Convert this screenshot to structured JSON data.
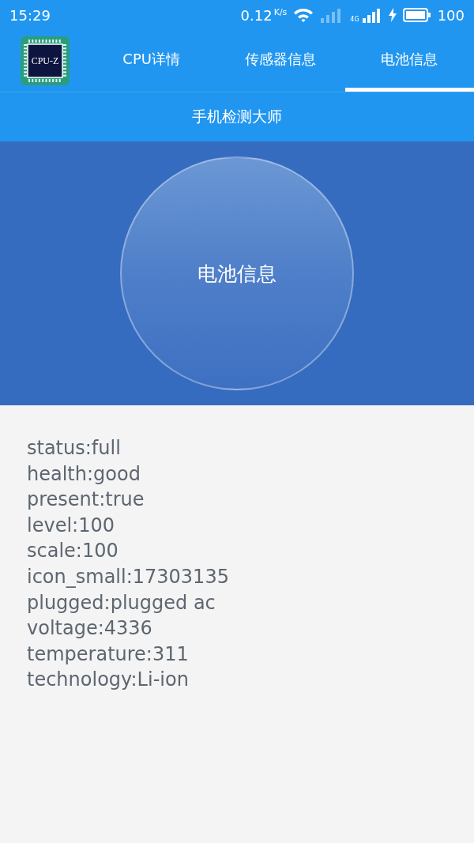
{
  "status_bar": {
    "time": "15:29",
    "speed": "0.12",
    "speed_unit": "K/s",
    "network_label": "4G",
    "battery": "100",
    "charging": true
  },
  "app_bar": {
    "logo_text": "CPU-Z",
    "tabs": [
      {
        "label": "CPU详情",
        "selected": false
      },
      {
        "label": "传感器信息",
        "selected": false
      },
      {
        "label": "电池信息",
        "selected": true
      }
    ]
  },
  "subtitle": "手机检测大师",
  "hero": {
    "label": "电池信息"
  },
  "info_lines": [
    "status:full",
    "health:good",
    "present:true",
    "level:100",
    "scale:100",
    "icon_small:17303135",
    "plugged:plugged ac",
    "voltage:4336",
    "temperature:311",
    "technology:Li-ion"
  ]
}
